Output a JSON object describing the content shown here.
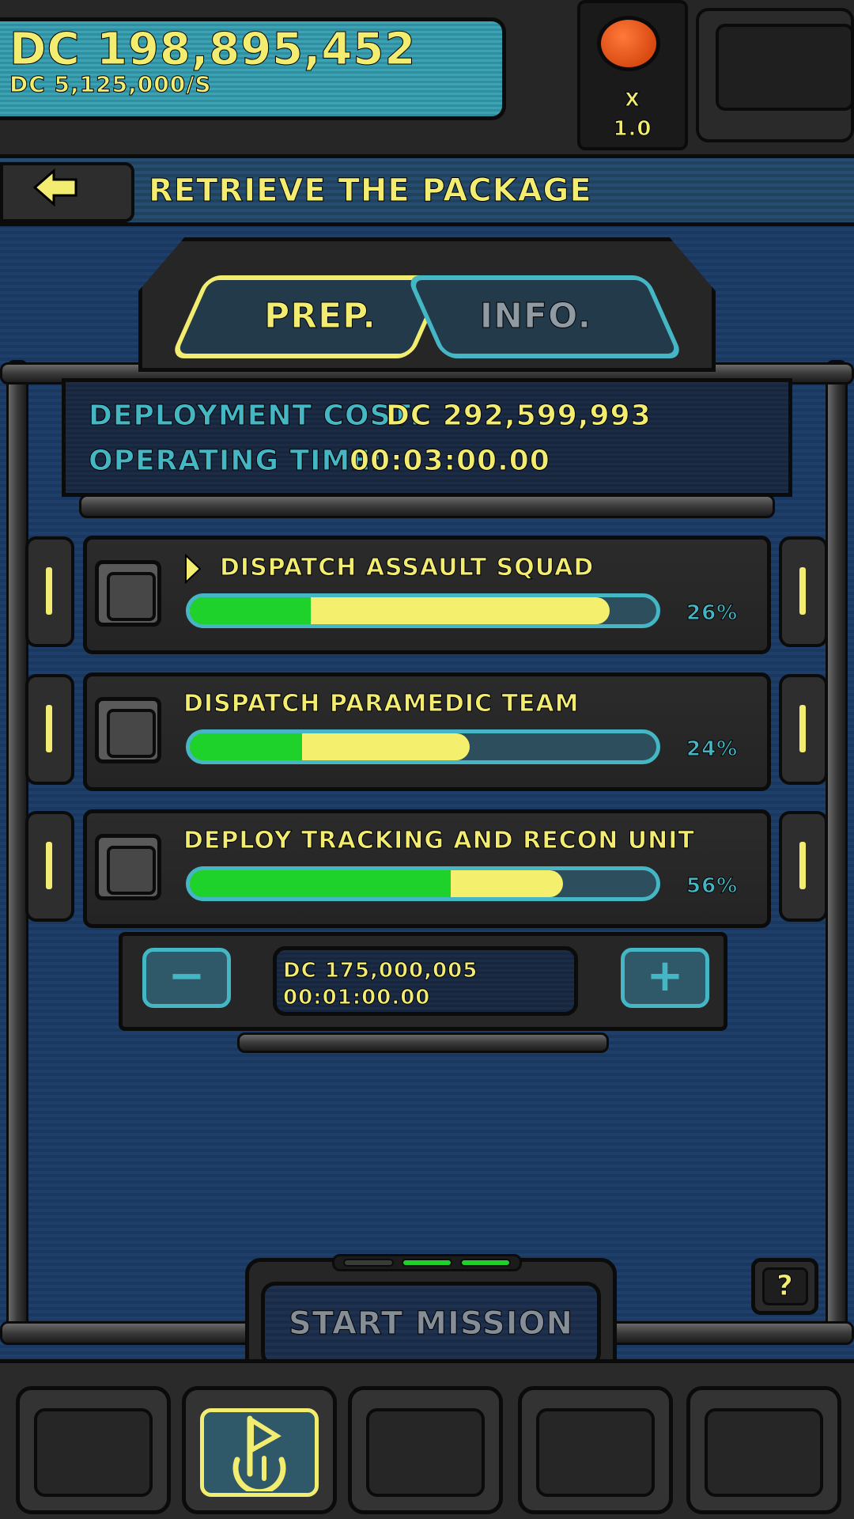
{
  "header": {
    "balance": "DC 198,895,452",
    "income_rate": "DC 5,125,000/S",
    "speed_label": "X",
    "speed_value": "1.0"
  },
  "mission": {
    "title": "RETRIEVE THE PACKAGE"
  },
  "tabs": [
    {
      "label": "PREP.",
      "active": true
    },
    {
      "label": "INFO.",
      "active": false
    }
  ],
  "summary": {
    "deployment_cost_label": "DEPLOYMENT COST:",
    "deployment_cost_value": "DC 292,599,993",
    "operating_time_label": "OPERATING TIME:",
    "operating_time_value": "00:03:00.00"
  },
  "tasks": [
    {
      "title": "DISPATCH ASSAULT SQUAD",
      "percent_label": "26%",
      "green_fraction": 0.26,
      "yellow_fraction": 0.9,
      "selected": true
    },
    {
      "title": "DISPATCH PARAMEDIC TEAM",
      "percent_label": "24%",
      "green_fraction": 0.24,
      "yellow_fraction": 0.6,
      "selected": false
    },
    {
      "title": "DEPLOY TRACKING AND RECON UNIT",
      "percent_label": "56%",
      "green_fraction": 0.56,
      "yellow_fraction": 0.8,
      "selected": false
    }
  ],
  "stepper": {
    "minus_label": "−",
    "plus_label": "+",
    "cost": "DC 175,000,005",
    "time": "00:01:00.00"
  },
  "actions": {
    "start_mission_label": "START MISSION",
    "help_label": "?"
  },
  "colors": {
    "accent_yellow": "#f2ec70",
    "accent_teal": "#44b6c4",
    "progress_green": "#1fd12b",
    "alarm_orange": "#e85a1c",
    "background_blue": "#1e3f6a"
  },
  "icons": {
    "back": "arrow-left-icon",
    "alarm": "alarm-button-icon",
    "help": "help-icon",
    "nav_active": "flag-emblem-icon"
  }
}
